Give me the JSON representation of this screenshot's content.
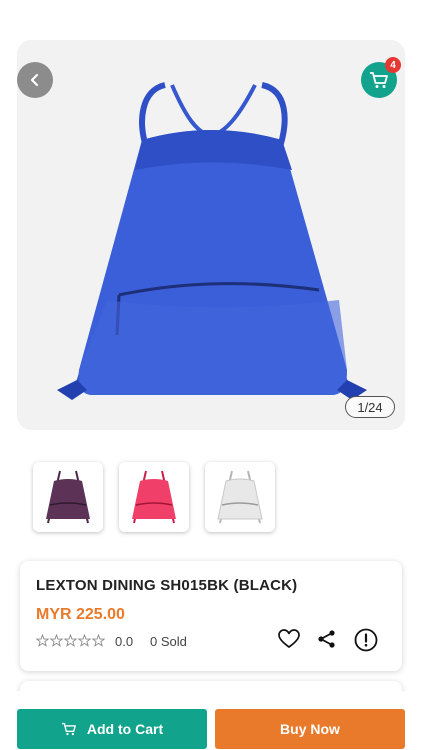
{
  "gallery": {
    "counter": "1/24",
    "cart_count": "4",
    "main_image": "blue-drawstring-bag",
    "thumbnails": [
      "purple-drawstring-bag",
      "pink-drawstring-bag",
      "white-drawstring-bag"
    ]
  },
  "product": {
    "title": "LEXTON DINING SH015BK (BLACK)",
    "price": "MYR 225.00",
    "rating": "0.0",
    "sold": "0 Sold",
    "stars_filled": 0,
    "stars_total": 5
  },
  "actions": {
    "add_to_cart": "Add to Cart",
    "buy_now": "Buy Now"
  },
  "colors": {
    "accent_teal": "#12a38c",
    "accent_orange": "#ea7a2b",
    "badge_red": "#e53935"
  }
}
